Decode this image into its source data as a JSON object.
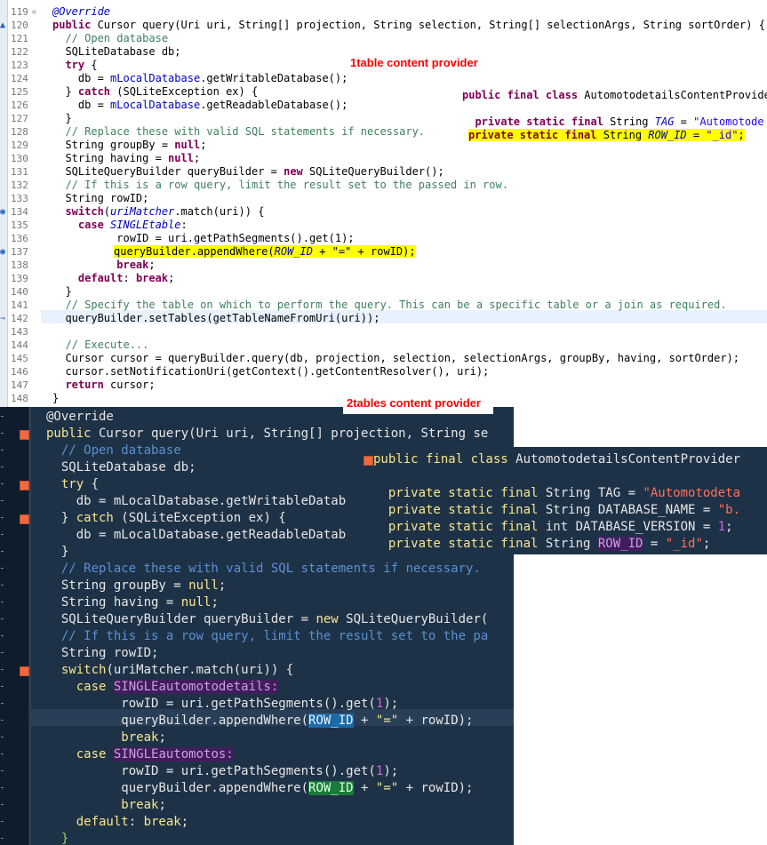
{
  "light_editor": {
    "line_numbers": [
      "119",
      "120",
      "121",
      "122",
      "123",
      "124",
      "125",
      "126",
      "127",
      "128",
      "129",
      "130",
      "131",
      "132",
      "133",
      "134",
      "135",
      "136",
      "137",
      "138",
      "139",
      "140",
      "141",
      "142",
      "143",
      "144",
      "145",
      "146",
      "147",
      "148"
    ],
    "lines": {
      "l119": "@Override",
      "l120a": "public",
      "l120b": " Cursor query(Uri uri, String[] projection, String selection, String[] selectionArgs, String sortOrder) {",
      "l121": "  // Open database",
      "l122": "  SQLiteDatabase db;",
      "l123a": "  try",
      "l123b": " {",
      "l124a": "    db = ",
      "l124b": "mLocalDatabase",
      "l124c": ".getWritableDatabase();",
      "l125a": "  } ",
      "l125b": "catch",
      "l125c": " (SQLiteException ex) {",
      "l126a": "    db = ",
      "l126b": "mLocalDatabase",
      "l126c": ".getReadableDatabase();",
      "l127": "  }",
      "l128": "  // Replace these with valid SQL statements if necessary.",
      "l129a": "  String groupBy = ",
      "l129b": "null",
      "l129c": ";",
      "l130a": "  String having = ",
      "l130b": "null",
      "l130c": ";",
      "l131a": "  SQLiteQueryBuilder queryBuilder = ",
      "l131b": "new",
      "l131c": " SQLiteQueryBuilder();",
      "l132": "  // If this is a row query, limit the result set to the passed in row.",
      "l133": "  String rowID;",
      "l134a": "  switch",
      "l134b": "(",
      "l134c": "uriMatcher",
      "l134d": ".match(uri)) {",
      "l135a": "    case",
      "l135b": " ",
      "l135c": "SINGLEtable",
      "l135d": ":",
      "l136": "          rowID = uri.getPathSegments().get(1);",
      "l137a": "queryBuilder.appendWhere(",
      "l137b": "ROW_ID",
      "l137c": " + \"=\" + rowID);",
      "l138a": "          ",
      "l138b": "break",
      "l138c": ";",
      "l139a": "    default",
      "l139b": ": ",
      "l139c": "break",
      "l139d": ";",
      "l140": "  }",
      "l141": "  // Specify the table on which to perform the query. This can be a specific table or a join as required.",
      "l142": "  queryBuilder.setTables(getTableNameFromUri(uri));",
      "l144": "  // Execute...",
      "l145": "  Cursor cursor = queryBuilder.query(db, projection, selection, selectionArgs, groupBy, having, sortOrder);",
      "l146": "  cursor.setNotificationUri(getContext().getContentResolver(), uri);",
      "l147a": "  return",
      "l147b": " cursor;",
      "l148": "}"
    },
    "class_popup": {
      "line1a": "public final class",
      "line1b": " AutomotodetailsContentProvide",
      "line2a": "  private static final",
      "line2b": " String ",
      "line2c": "TAG",
      "line2d": " = ",
      "line2e": "\"Automotode",
      "line3a": "private static final",
      "line3b": " String ",
      "line3c": "ROW_ID",
      "line3d": " = ",
      "line3e": "\"_id\"",
      "line3f": ";"
    }
  },
  "annotations": {
    "one_table": "1table content provider",
    "two_tables": "2tables content provider"
  },
  "dark_editor": {
    "lines": {
      "d1": "@Override",
      "d2a": "public",
      "d2b": " Cursor query(Uri uri, String[] projection, String se",
      "d3": "  // Open database",
      "d4": "  SQLiteDatabase db;",
      "d5a": "  try",
      "d5b": " {",
      "d6": "    db = mLocalDatabase.getWritableDatab",
      "d7a": "  } ",
      "d7b": "catch",
      "d7c": " (SQLiteException ex) {",
      "d8": "    db = mLocalDatabase.getReadableDatab",
      "d9": "  }",
      "d10": "  // Replace these with valid SQL statements if necessary.",
      "d11a": "  String groupBy = ",
      "d11b": "null",
      "d11c": ";",
      "d12a": "  String having = ",
      "d12b": "null",
      "d12c": ";",
      "d13a": "  SQLiteQueryBuilder queryBuilder = ",
      "d13b": "new",
      "d13c": " SQLiteQueryBuilder(",
      "d14": "  // If this is a row query, limit the result set to the pa",
      "d15": "  String rowID;",
      "d16a": "  switch",
      "d16b": "(uriMatcher.match(uri)) {",
      "d17a": "    case",
      "d17b": " ",
      "d17c": "SINGLEautomotodetails:",
      "d18a": "          rowID = uri.getPathSegments().get(",
      "d18b": "1",
      "d18c": ");",
      "d19a": "          queryBuilder.appendWhere(",
      "d19b": "ROW_ID",
      "d19c": " + ",
      "d19d": "\"=\"",
      "d19e": " + rowID);",
      "d20a": "          ",
      "d20b": "break",
      "d20c": ";",
      "d21a": "    case",
      "d21b": " ",
      "d21c": "SINGLEautomotos:",
      "d22a": "          rowID = uri.getPathSegments().get(",
      "d22b": "1",
      "d22c": ");",
      "d23a": "          queryBuilder.appendWhere(",
      "d23b": "ROW_ID",
      "d23c": " + ",
      "d23d": "\"=\"",
      "d23e": " + rowID);",
      "d24a": "          ",
      "d24b": "break",
      "d24c": ";",
      "d25a": "    default",
      "d25b": ": ",
      "d25c": "break",
      "d25d": ";",
      "d26": "  }"
    },
    "class_popup": {
      "p1a": "public final class",
      "p1b": " AutomotodetailsContentProvider",
      "p2a": "  private static final",
      "p2b": " String TAG = ",
      "p2c": "\"Automotodeta",
      "p3a": "  private static final",
      "p3b": " String DATABASE_NAME = ",
      "p3c": "\"b.",
      "p4a": "  private static final",
      "p4b": " int DATABASE_VERSION = ",
      "p4c": "1",
      "p4d": ";",
      "p5a": "  private static final",
      "p5b": " String ",
      "p5c": "ROW_ID",
      "p5d": " = ",
      "p5e": "\"_id\"",
      "p5f": ";"
    }
  },
  "colors": {
    "light_background": "#ffffff",
    "dark_background": "#1e3247",
    "highlight": "#ffff00",
    "annotation": "#ff0000"
  }
}
